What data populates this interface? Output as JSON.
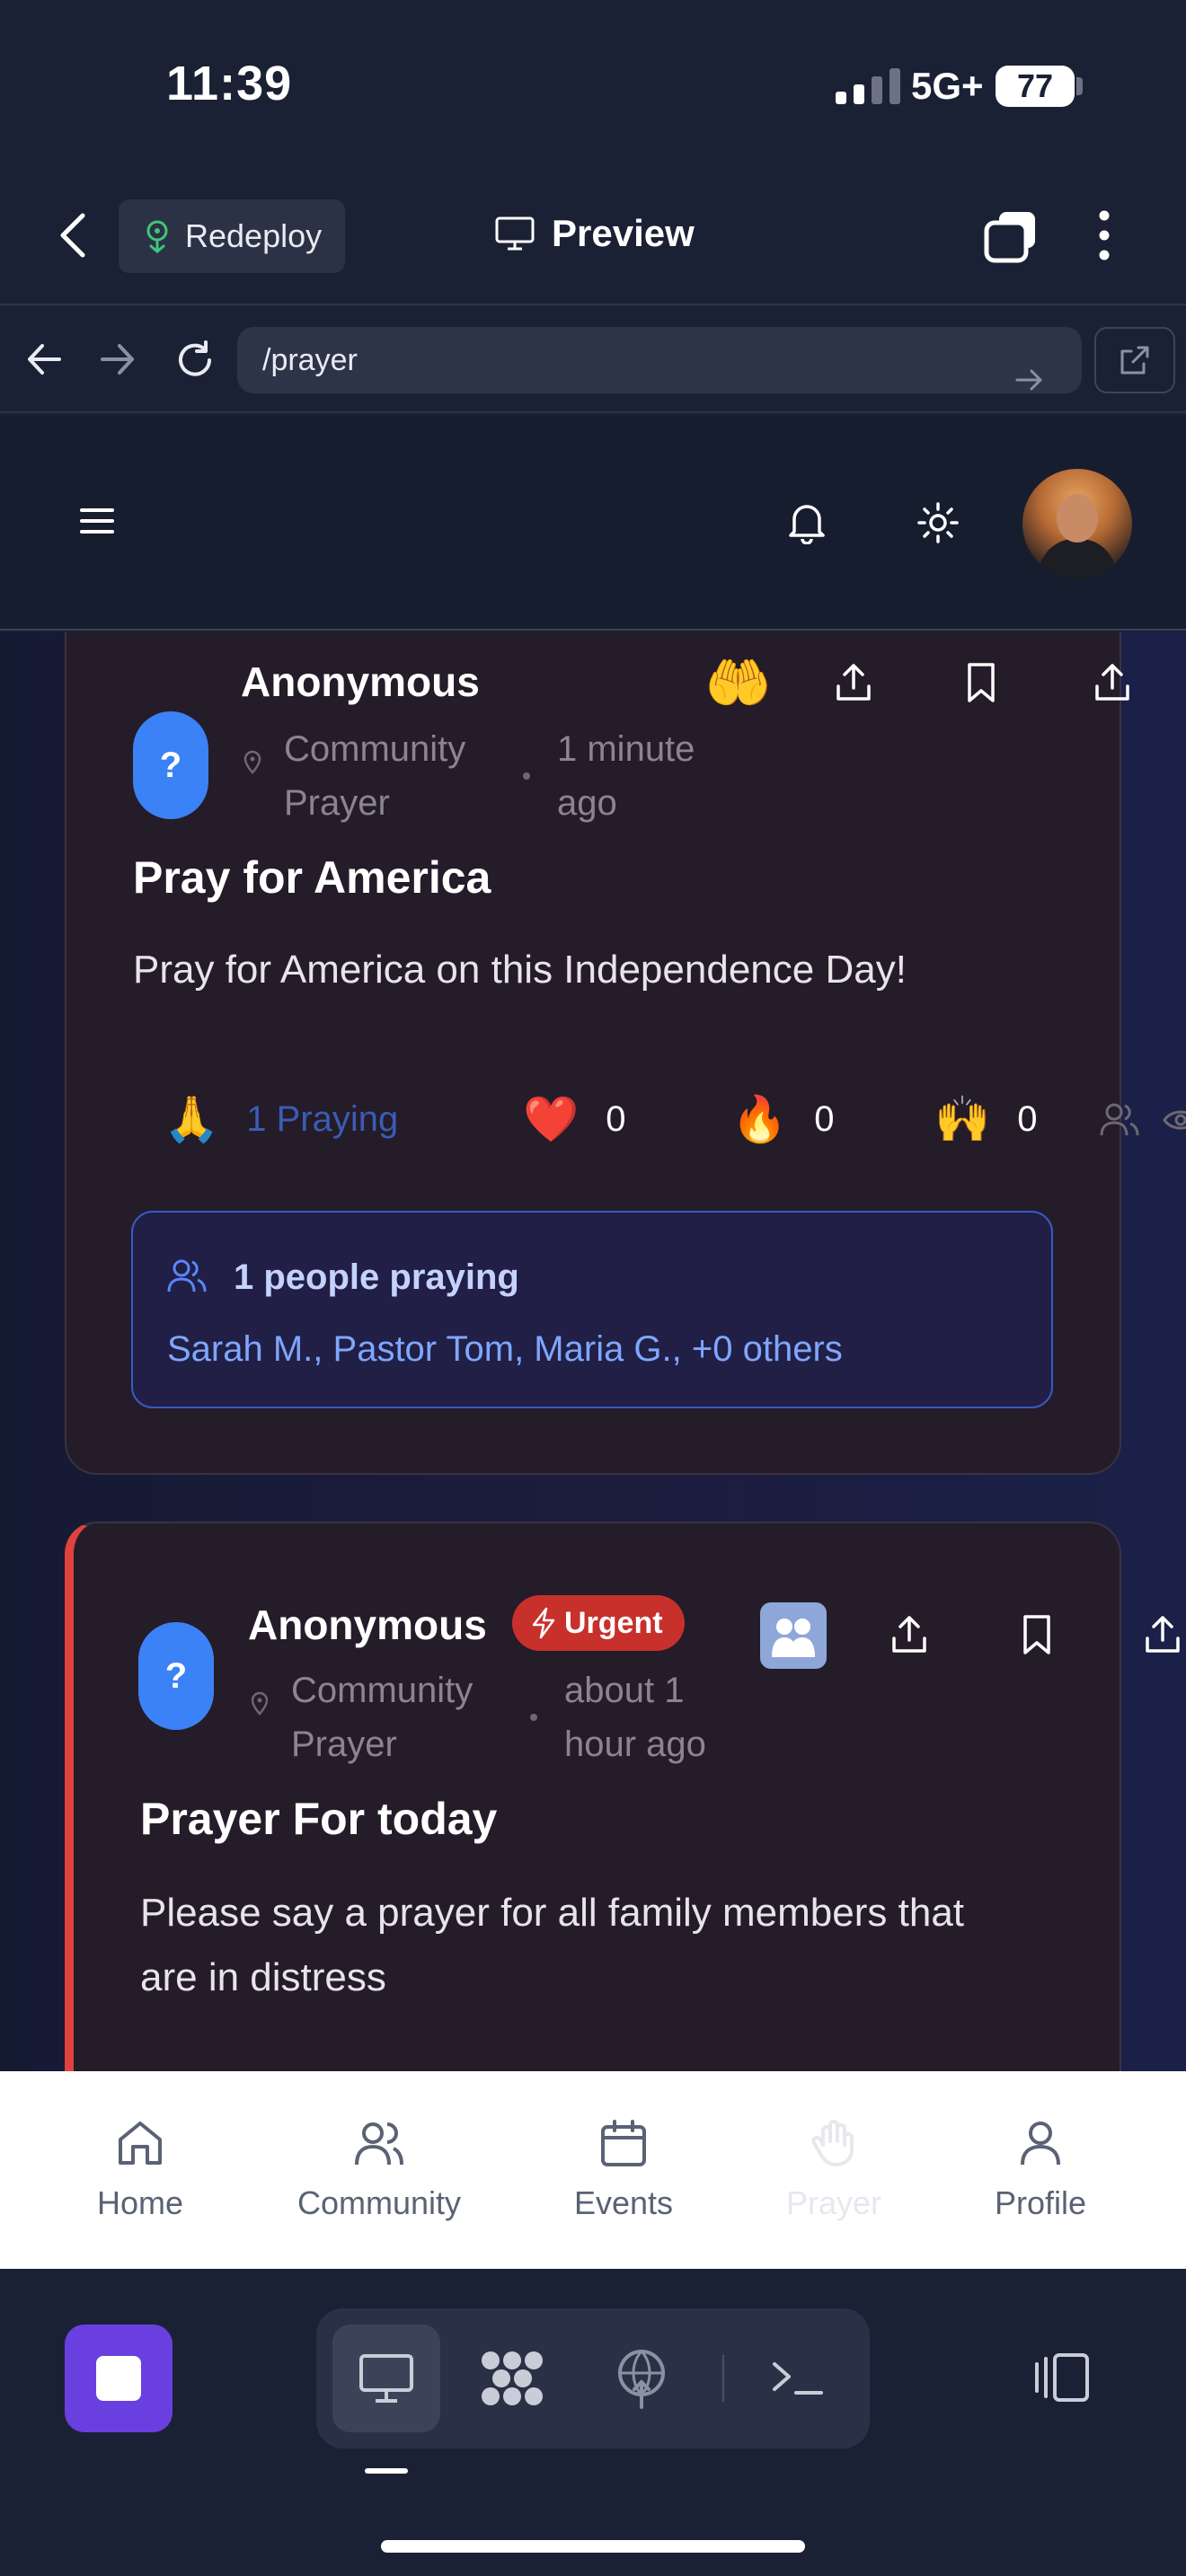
{
  "status_bar": {
    "time": "11:39",
    "network": "5G+",
    "battery": "77"
  },
  "toolbar": {
    "redeploy_label": "Redeploy",
    "preview_label": "Preview"
  },
  "browser": {
    "url": "/prayer"
  },
  "posts": [
    {
      "author": "Anonymous",
      "avatar_letter": "?",
      "category_line1": "Community",
      "category_line2": "Prayer",
      "time_line1": "1 minute",
      "time_line2": "ago",
      "reaction_emoji": "🤲",
      "title": "Pray for America",
      "body": "Pray for America on this Independence Day!",
      "reactions": [
        {
          "emoji": "🙏",
          "label": "1  Praying"
        },
        {
          "emoji": "❤️",
          "count": "0"
        },
        {
          "emoji": "🔥",
          "count": "0"
        },
        {
          "emoji": "🙌",
          "count": "0"
        }
      ],
      "praying_box": {
        "title": "1 people praying",
        "names": "Sarah M., Pastor Tom, Maria G., +0 others"
      }
    },
    {
      "author": "Anonymous",
      "avatar_letter": "?",
      "badge": "Urgent",
      "category_line1": "Community",
      "category_line2": "Prayer",
      "time_line1": "about 1",
      "time_line2": "hour ago",
      "title": "Prayer For today",
      "body_line1": "Please say a prayer for all family members that",
      "body_line2": "are in distress"
    }
  ],
  "bottom_nav": [
    {
      "label": "Home",
      "icon": "home-icon"
    },
    {
      "label": "Community",
      "icon": "users-icon"
    },
    {
      "label": "Events",
      "icon": "calendar-icon"
    },
    {
      "label": "Prayer",
      "icon": "hand-icon",
      "active": true
    },
    {
      "label": "Profile",
      "icon": "user-icon"
    }
  ],
  "colors": {
    "accent": "#3b82f6",
    "urgent": "#c8302c",
    "stop_button": "#6a3fe0"
  }
}
